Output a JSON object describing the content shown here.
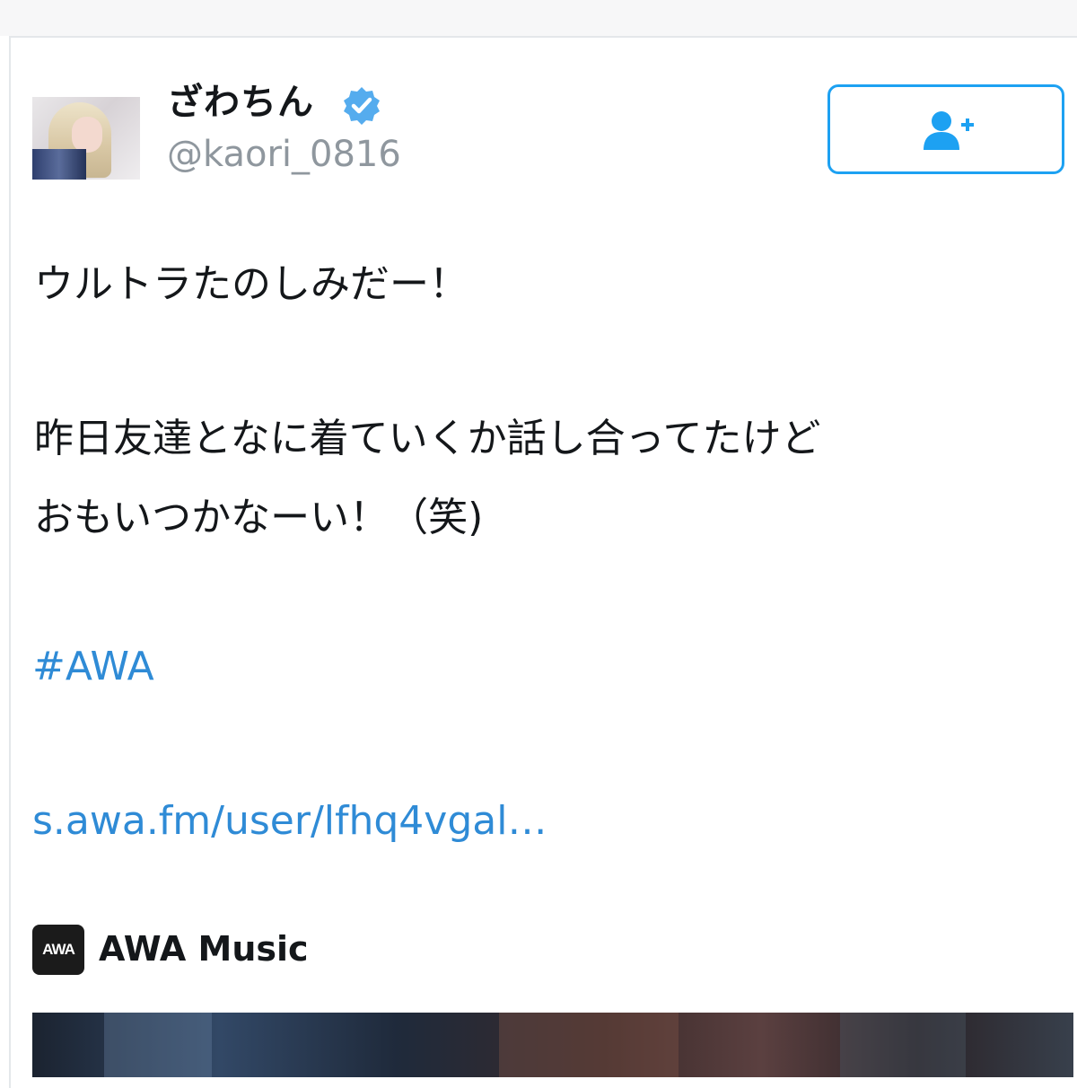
{
  "user": {
    "display_name": "ざわちん",
    "handle": "@kaori_0816",
    "verified": true
  },
  "follow_button": {
    "icon": "follow-person-plus-icon"
  },
  "tweet": {
    "line1": "ウルトラたのしみだー！",
    "line2": "昨日友達となに着ていくか話し合ってたけど",
    "line3": "おもいつかなーい！（笑)",
    "hashtag": "#AWA",
    "url": "s.awa.fm/user/lfhq4vgal…"
  },
  "card": {
    "logo_text": "AWA",
    "title": "AWA Music"
  },
  "colors": {
    "accent": "#1da1f2",
    "link": "#2f8bd6",
    "text": "#14171a",
    "muted": "#8f979e"
  }
}
